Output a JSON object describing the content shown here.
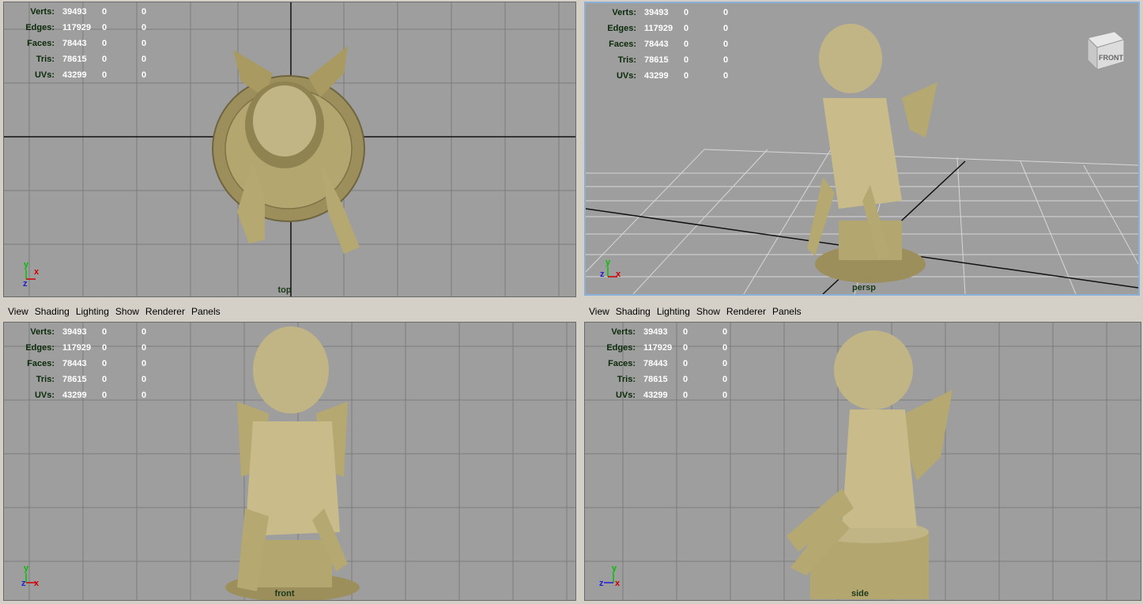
{
  "menu": [
    "View",
    "Shading",
    "Lighting",
    "Show",
    "Renderer",
    "Panels"
  ],
  "hud": {
    "labels": [
      "Verts:",
      "Edges:",
      "Faces:",
      "Tris:",
      "UVs:"
    ],
    "values": [
      [
        "39493",
        "0",
        "0"
      ],
      [
        "117929",
        "0",
        "0"
      ],
      [
        "78443",
        "0",
        "0"
      ],
      [
        "78615",
        "0",
        "0"
      ],
      [
        "43299",
        "0",
        "0"
      ]
    ]
  },
  "viewports": {
    "top": {
      "camera": "top"
    },
    "persp": {
      "camera": "persp",
      "viewcube": "FRONT"
    },
    "front": {
      "camera": "front"
    },
    "side": {
      "camera": "side"
    }
  },
  "axes": {
    "x": "x",
    "y": "y",
    "z": "z"
  },
  "colors": {
    "viewport_bg": "#9e9e9e",
    "grid": "#7a7a7a",
    "hud_label": "#0a2a0a",
    "hud_value": "#ffffff",
    "statue": "#b8ac7a",
    "active_border": "#8ab0d8",
    "axis_x": "#d00000",
    "axis_y": "#00c000",
    "axis_z": "#2020d0"
  }
}
